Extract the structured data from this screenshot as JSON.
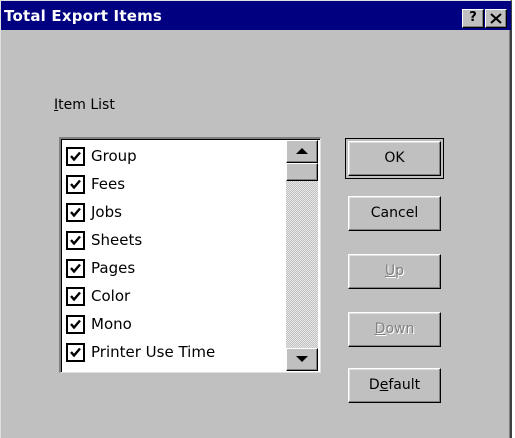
{
  "window": {
    "title": "Total Export Items",
    "help_label": "?",
    "close_label": "×"
  },
  "item_list": {
    "label": "Item List",
    "label_accel": "I",
    "label_rest": "tem List",
    "items": [
      {
        "label": "Group",
        "checked": true
      },
      {
        "label": "Fees",
        "checked": true
      },
      {
        "label": "Jobs",
        "checked": true
      },
      {
        "label": "Sheets",
        "checked": true
      },
      {
        "label": "Pages",
        "checked": true
      },
      {
        "label": "Color",
        "checked": true
      },
      {
        "label": "Mono",
        "checked": true
      },
      {
        "label": "Printer Use Time",
        "checked": true
      }
    ]
  },
  "buttons": {
    "ok": {
      "label": "OK",
      "enabled": true,
      "default": true
    },
    "cancel": {
      "label": "Cancel",
      "enabled": true
    },
    "up": {
      "label": "Up",
      "accel": "U",
      "rest": "p",
      "enabled": false
    },
    "down": {
      "label": "Down",
      "accel": "D",
      "rest": "own",
      "enabled": false
    },
    "default": {
      "label": "Default",
      "pre": "D",
      "accel": "e",
      "rest": "fault",
      "enabled": true
    }
  },
  "colors": {
    "titlebar": "#000080",
    "face": "#c0c0c0",
    "disabled_text": "#808080"
  }
}
